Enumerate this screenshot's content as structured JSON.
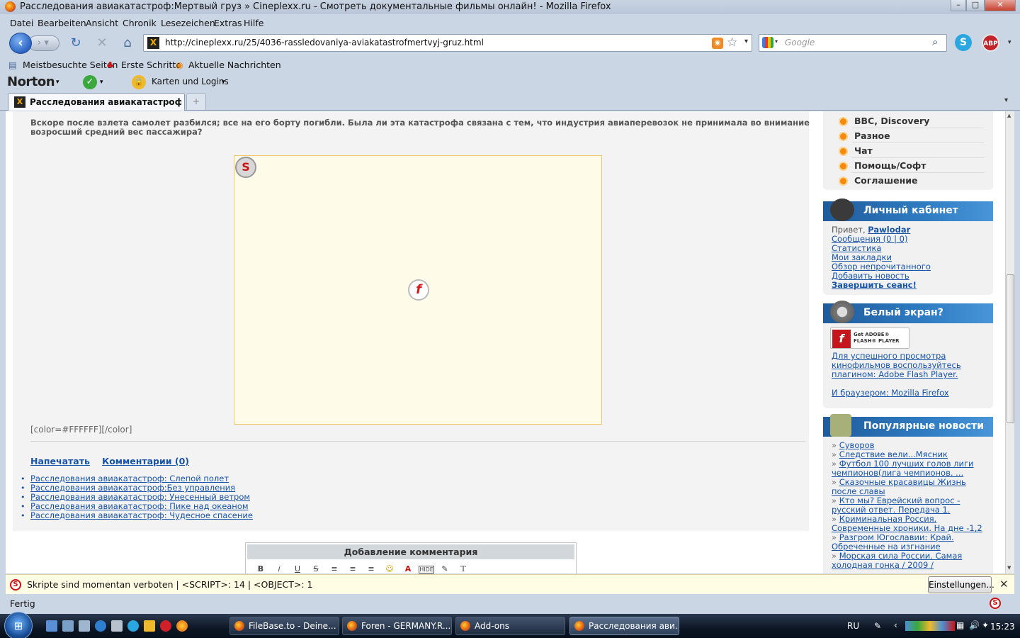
{
  "window": {
    "title": "Расследования авиакатастроф:Мертвый груз » Cineplexx.ru - Смотреть документальные фильмы онлайн! - Mozilla Firefox"
  },
  "menu": [
    "Datei",
    "Bearbeiten",
    "Ansicht",
    "Chronik",
    "Lesezeichen",
    "Extras",
    "Hilfe"
  ],
  "navigation": {
    "url": "http://cineplexx.ru/25/4036-rassledovaniya-aviakatastrofmertvyj-gruz.html",
    "search_placeholder": "Google"
  },
  "bookmarks": [
    "Meistbesuchte Seiten",
    "Erste Schritte",
    "Aktuelle Nachrichten"
  ],
  "norton": {
    "logo": "Norton",
    "logins": "Karten und Logins"
  },
  "tab": {
    "label": "Расследования авиакатастроф:Мер..."
  },
  "article": {
    "description": "Вскоре после взлета самолет разбился; все на его борту погибли. Была ли эта катастрофа связана с тем, что индустрия авиаперевозок не принимала во внимание возросший средний вес пассажира?",
    "color_tag": "[color=#FFFFFF][/color]",
    "print_link": "Напечатать",
    "comments_link": "Комментарии (0)",
    "related": [
      "Расследования авиакатастроф: Слепой полет",
      "Расследования авиакатастроф:Без управления",
      "Расследования авиакатастроф: Унесенный ветром",
      "Расследования авиакатастроф: Пике над океаном",
      "Расследования авиакатастроф: Чудесное спасение"
    ],
    "comment_box_title": "Добавление комментария",
    "toolbar": [
      "B",
      "i",
      "U",
      "S",
      "≡",
      "≡",
      "≡",
      "☺",
      "A",
      "HIDE",
      "✎",
      "T"
    ]
  },
  "sidebar": {
    "menu": [
      "BBC, Discovery",
      "Разное",
      "Чат",
      "Помощь/Софт",
      "Соглашение"
    ],
    "cabinet": {
      "title": "Личный кабинет",
      "greeting": "Привет,",
      "user": "Pawlodar",
      "links": [
        "Сообщения (0 | 0)",
        "Статистика",
        "Мои закладки",
        "Обзор непрочитанного",
        "Добавить новость"
      ],
      "logout": "Завершить сеанс!"
    },
    "whitescreen": {
      "title": "Белый экран?",
      "badge_line1": "Get ADOBE®",
      "badge_line2": "FLASH® PLAYER",
      "text": "Для успешного просмотра кинофильмов воспользуйтесь плагином: Adobe Flash Player.",
      "browser": "И браузером: Mozilla Firefox"
    },
    "popular": {
      "title": "Популярные новости",
      "items": [
        "Суворов",
        "Следствие вели...Мясник",
        "Футбол 100 лучших голов лиги чемпионов(лига чемпионов. ...",
        "Сказочные красавицы Жизнь после славы",
        "Кто мы? Еврейский вопрос - русский ответ. Передача 1.",
        "Криминальная Россия. Современные хроники. На дне -1,2",
        "Разгром Югославии: Край. Обреченные на изгнание",
        "Морская сила России. Самая холодная гонка / 2009 /"
      ]
    }
  },
  "noscript_bar": {
    "text": "Skripte sind momentan verboten | <SCRIPT>: 14 | <OBJECT>: 1",
    "button": "Einstellungen..."
  },
  "status": {
    "text": "Fertig"
  },
  "taskbar": {
    "tasks": [
      "FileBase.to - Deine...",
      "Foren - GERMANY.R...",
      "Add-ons",
      "Расследования ави..."
    ],
    "lang": "RU",
    "clock": "15:23"
  }
}
